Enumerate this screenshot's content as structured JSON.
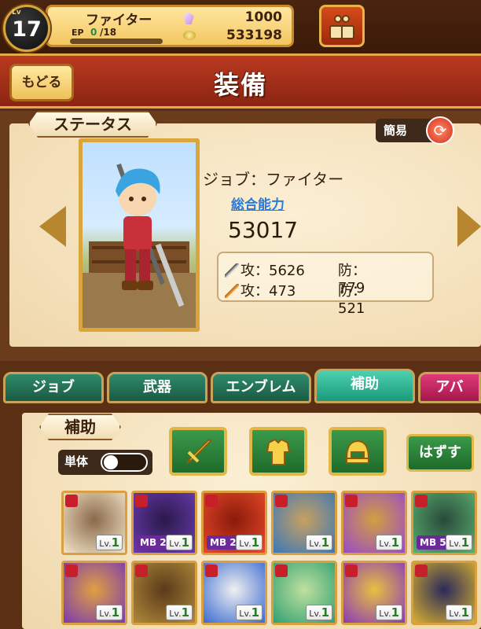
{
  "player": {
    "level_tag": "Lv",
    "level": "17",
    "job": "ファイター",
    "ep_label": "EP",
    "ep_current": "0",
    "ep_max": "/18",
    "crystals": "1000",
    "gold": "533198"
  },
  "header": {
    "back_label": "もどる",
    "title": "装備"
  },
  "status": {
    "section_label": "ステータス",
    "simple_label": "簡易",
    "job_line": "ジョブ：ファイター",
    "power_label": "総合能力",
    "power_value": "53017",
    "physical": {
      "atk": "攻：5626",
      "def": "防：779"
    },
    "magic": {
      "atk": "攻：473",
      "def": "防：521"
    }
  },
  "tabs": [
    {
      "label": "ジョブ",
      "active": false
    },
    {
      "label": "武器",
      "active": false
    },
    {
      "label": "エンブレム",
      "active": false
    },
    {
      "label": "補助",
      "active": true
    },
    {
      "label": "アバ",
      "active": false
    }
  ],
  "support": {
    "section_label": "補助",
    "single_label": "単体",
    "remove_label": "はずす",
    "equip_icons": [
      "sword-icon",
      "armor-icon",
      "helmet-icon"
    ]
  },
  "cards": [
    {
      "mb": "",
      "lv_prefix": "Lv.",
      "lv": "1"
    },
    {
      "mb": "MB 2",
      "lv_prefix": "Lv.",
      "lv": "1"
    },
    {
      "mb": "MB 2",
      "lv_prefix": "Lv.",
      "lv": "1"
    },
    {
      "mb": "",
      "lv_prefix": "Lv.",
      "lv": "1"
    },
    {
      "mb": "",
      "lv_prefix": "Lv.",
      "lv": "1"
    },
    {
      "mb": "MB 5",
      "lv_prefix": "Lv.",
      "lv": "1"
    },
    {
      "mb": "",
      "lv_prefix": "Lv.",
      "lv": "1"
    },
    {
      "mb": "",
      "lv_prefix": "Lv.",
      "lv": "1"
    },
    {
      "mb": "",
      "lv_prefix": "Lv.",
      "lv": "1"
    },
    {
      "mb": "",
      "lv_prefix": "Lv.",
      "lv": "1"
    },
    {
      "mb": "",
      "lv_prefix": "Lv.",
      "lv": "1"
    },
    {
      "mb": "",
      "lv_prefix": "Lv.",
      "lv": "1"
    }
  ],
  "colors": {
    "accent_gold": "#d9a53c",
    "header_red": "#b93a20",
    "tab_green": "#2e8a6a",
    "tab_active": "#4cd0b0",
    "power_blue": "#2a7ad8"
  }
}
